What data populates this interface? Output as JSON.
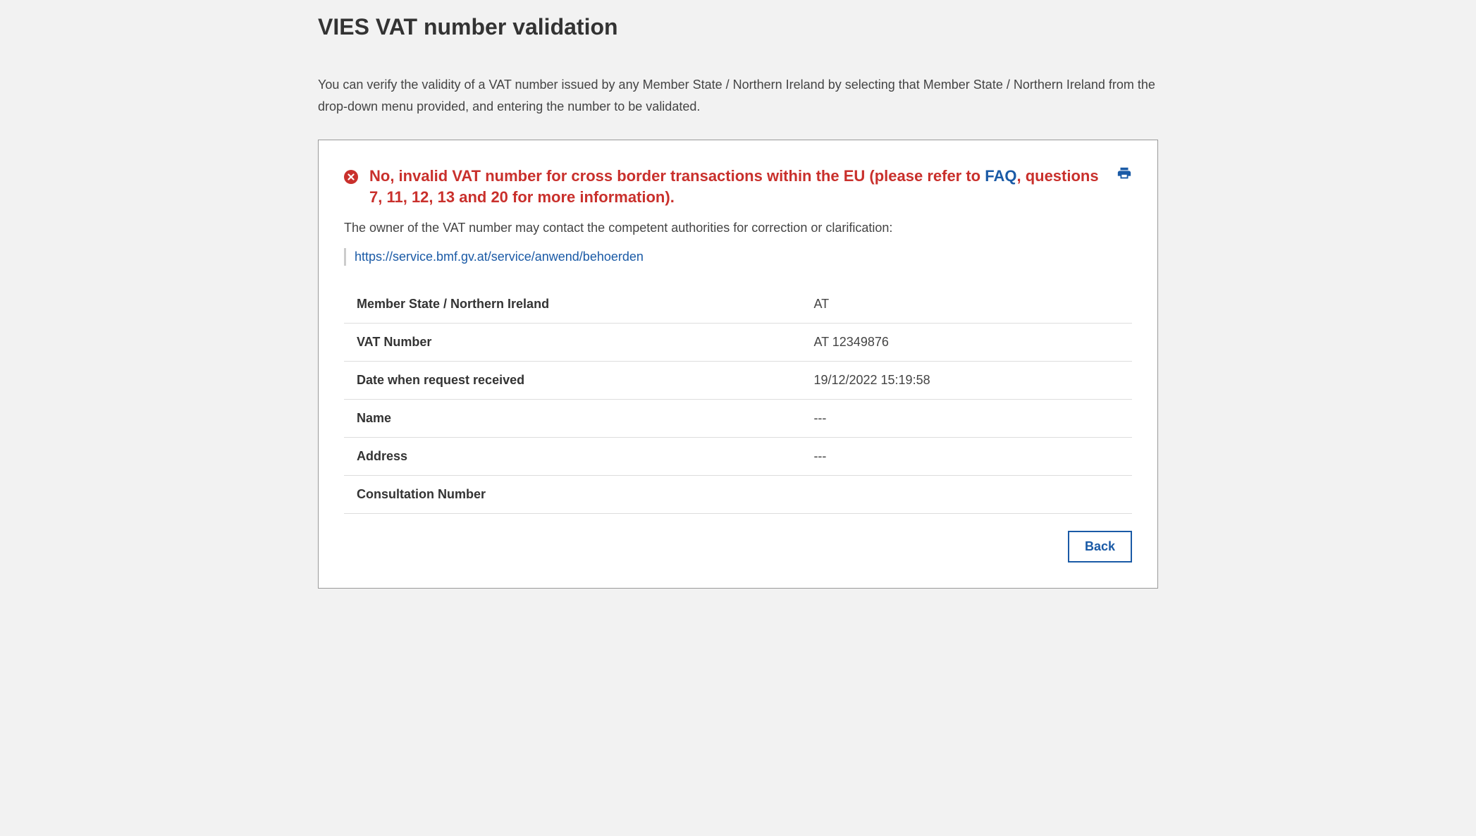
{
  "page": {
    "title": "VIES VAT number validation",
    "intro": "You can verify the validity of a VAT number issued by any Member State / Northern Ireland by selecting that Member State / Northern Ireland from the drop-down menu provided, and entering the number to be validated."
  },
  "result": {
    "alert_prefix": "No, invalid VAT number for cross border transactions within the EU (please refer to ",
    "faq_label": "FAQ",
    "alert_suffix": ", questions 7, 11, 12, 13 and 20 for more information).",
    "owner_note": "The owner of the VAT number may contact the competent authorities for correction or clarification:",
    "authority_url": "https://service.bmf.gv.at/service/anwend/behoerden",
    "rows": {
      "member_state": {
        "label": "Member State / Northern Ireland",
        "value": "AT"
      },
      "vat_number": {
        "label": "VAT Number",
        "value": "AT 12349876"
      },
      "request_date": {
        "label": "Date when request received",
        "value": "19/12/2022 15:19:58"
      },
      "name": {
        "label": "Name",
        "value": "---"
      },
      "address": {
        "label": "Address",
        "value": "---"
      },
      "consultation_number": {
        "label": "Consultation Number",
        "value": ""
      }
    },
    "back_label": "Back"
  }
}
